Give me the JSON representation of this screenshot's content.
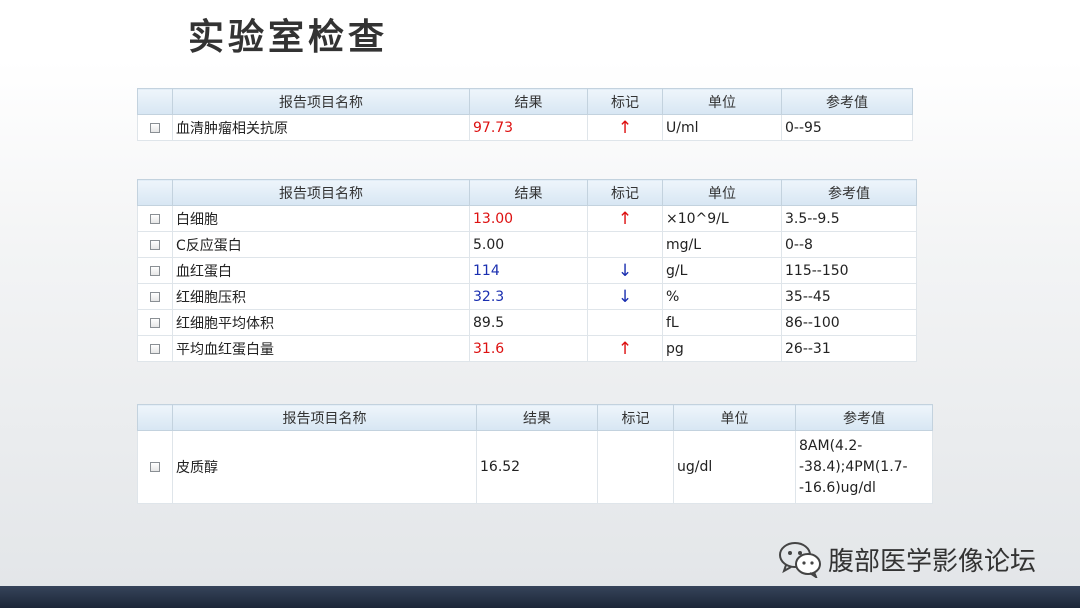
{
  "title": "实验室检查",
  "headers": {
    "name": "报告项目名称",
    "result": "结果",
    "flag": "标记",
    "unit": "单位",
    "reference": "参考值"
  },
  "table1": {
    "rows": [
      {
        "name": "血清肿瘤相关抗原",
        "result": "97.73",
        "flag": "↑",
        "unit": "U/ml",
        "reference": "0--95"
      }
    ]
  },
  "table2": {
    "rows": [
      {
        "name": "白细胞",
        "result": "13.00",
        "flag": "↑",
        "unit": "×10^9/L",
        "reference": "3.5--9.5"
      },
      {
        "name": "C反应蛋白",
        "result": "5.00",
        "flag": "",
        "unit": "mg/L",
        "reference": "0--8"
      },
      {
        "name": "血红蛋白",
        "result": "114",
        "flag": "↓",
        "unit": "g/L",
        "reference": "115--150"
      },
      {
        "name": "红细胞压积",
        "result": "32.3",
        "flag": "↓",
        "unit": "%",
        "reference": "35--45"
      },
      {
        "name": "红细胞平均体积",
        "result": "89.5",
        "flag": "",
        "unit": "fL",
        "reference": "86--100"
      },
      {
        "name": "平均血红蛋白量",
        "result": "31.6",
        "flag": "↑",
        "unit": "pg",
        "reference": "26--31"
      }
    ]
  },
  "table3": {
    "rows": [
      {
        "name": "皮质醇",
        "result": "16.52",
        "flag": "",
        "unit": "ug/dl",
        "reference": "8AM(4.2--38.4);4PM(1.7--16.6)ug/dl"
      }
    ]
  },
  "colors": {
    "high": "#dd1111",
    "low": "#1a2fb0",
    "header": "#d7e6f3"
  },
  "icons": {
    "watermark": "wechat-icon",
    "row_select": "checkbox-icon"
  },
  "watermark": {
    "text": "腹部医学影像论坛"
  }
}
